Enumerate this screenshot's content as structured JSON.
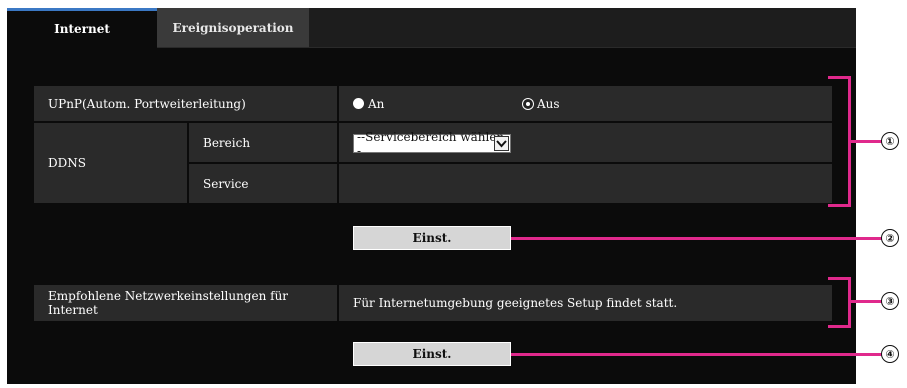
{
  "tabs": [
    {
      "label": "Internet",
      "active": true
    },
    {
      "label": "Ereignisoperation",
      "active": false
    }
  ],
  "upnp": {
    "label": "UPnP(Autom. Portweiterleitung)",
    "options": [
      {
        "label": "An",
        "selected": false
      },
      {
        "label": "Aus",
        "selected": true
      }
    ]
  },
  "ddns": {
    "label": "DDNS",
    "bereich_label": "Bereich",
    "bereich_value": "--Servicebereich wählen--",
    "service_label": "Service"
  },
  "set_button_1": "Einst.",
  "recommended": {
    "label": "Empfohlene Netzwerkeinstellungen für Internet",
    "value": "Für Internetumgebung geeignetes Setup findet statt."
  },
  "set_button_2": "Einst.",
  "annotations": [
    "①",
    "②",
    "③",
    "④"
  ],
  "colors": {
    "annotation": "#e0298c",
    "tab_accent": "#3b78c4"
  }
}
